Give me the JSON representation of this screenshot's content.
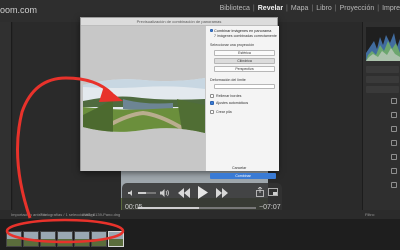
{
  "header": {
    "site_tag": "oom.com",
    "modules": [
      {
        "label": "Biblioteca",
        "active": false
      },
      {
        "label": "Revelar",
        "active": true
      },
      {
        "label": "Mapa",
        "active": false
      },
      {
        "label": "Libro",
        "active": false
      },
      {
        "label": "Proyección",
        "active": false
      },
      {
        "label": "Impre",
        "active": false
      }
    ],
    "separator": "|"
  },
  "dialog": {
    "title": "Previsualización de combinación de panoramas",
    "options": {
      "heading": "Combinar imágenes en panorama",
      "subheading": "7 imágenes combinadas correctamente",
      "projection_label": "Seleccionar una proyección",
      "projections": [
        {
          "label": "Esférica",
          "selected": false
        },
        {
          "label": "Cilíndrica",
          "selected": true
        },
        {
          "label": "Perspectiva",
          "selected": false
        }
      ],
      "boundary_label": "Deformación del límite",
      "fill_edges_label": "Rellenar bordes",
      "auto_settings_label": "Ajustes automáticos",
      "crop_label": "Crear pila",
      "cancel_label": "Cancelar",
      "merge_label": "Combinar"
    }
  },
  "video": {
    "elapsed": "00:05",
    "remaining": "−07:07",
    "progress": 0.52,
    "volume": 0.45
  },
  "filmstrip": {
    "source_label": "Importación anterior",
    "info_label": "7 fotografías / 1 seleccionadas",
    "file_label": "/IMG_8139-Pano.dng",
    "filter_label": "Filtro:"
  },
  "colors": {
    "annotation": "#e8322b",
    "merge_button": "#3a7bd5"
  }
}
